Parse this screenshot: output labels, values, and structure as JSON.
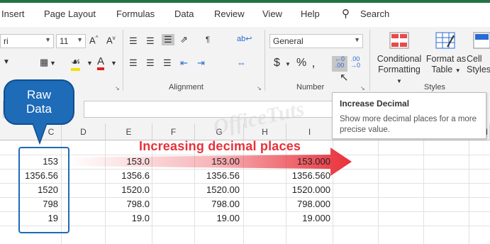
{
  "ribbon_tabs": [
    "Insert",
    "Page Layout",
    "Formulas",
    "Data",
    "Review",
    "View",
    "Help"
  ],
  "search_label": "Search",
  "font": {
    "name": "ri",
    "size": "11"
  },
  "number_format": "General",
  "groups": {
    "alignment": "Alignment",
    "number": "Number",
    "styles": "Styles"
  },
  "styles_buttons": {
    "conditional": "Conditional",
    "conditional_sub": "Formatting",
    "format_as": "Format as",
    "format_as_sub": "Table",
    "cell": "Cell",
    "cell_sub": "Styles"
  },
  "tooltip": {
    "title": "Increase Decimal",
    "body": "Show more decimal places for a more precise value."
  },
  "watermark": "OfficeTuts",
  "columns": [
    "C",
    "D",
    "E",
    "F",
    "G",
    "H",
    "I",
    "M"
  ],
  "callout_label": "Raw Data",
  "arrow_label": "Increasing decimal places",
  "rows": [
    {
      "c": "153",
      "e": "153.0",
      "g": "153.00",
      "i": "153.000"
    },
    {
      "c": "1356.56",
      "e": "1356.6",
      "g": "1356.56",
      "i": "1356.560"
    },
    {
      "c": "1520",
      "e": "1520.0",
      "g": "1520.00",
      "i": "1520.000"
    },
    {
      "c": "798",
      "e": "798.0",
      "g": "798.00",
      "i": "798.000"
    },
    {
      "c": "19",
      "e": "19.0",
      "g": "19.00",
      "i": "19.000"
    }
  ],
  "colors": {
    "excel_green": "#217346",
    "callout_blue": "#1e6bb8",
    "arrow_red": "#e8303a"
  }
}
